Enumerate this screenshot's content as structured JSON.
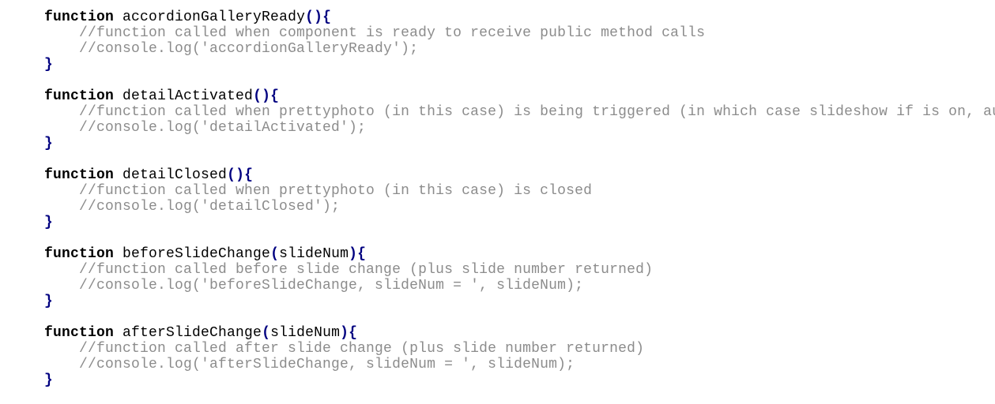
{
  "keyword": "function",
  "blocks": [
    {
      "name": "accordionGalleryReady",
      "param": "",
      "comment1": "//function called when component is ready to receive public method calls",
      "comment2": "//console.log('accordionGalleryReady');"
    },
    {
      "name": "detailActivated",
      "param": "",
      "comment1": "//function called when prettyphoto (in this case) is being triggered (in which case slideshow if is on, au",
      "comment2": "//console.log('detailActivated');"
    },
    {
      "name": "detailClosed",
      "param": "",
      "comment1": "//function called when prettyphoto (in this case) is closed",
      "comment2": "//console.log('detailClosed');"
    },
    {
      "name": "beforeSlideChange",
      "param": "slideNum",
      "comment1": "//function called before slide change (plus slide number returned)",
      "comment2": "//console.log('beforeSlideChange, slideNum = ', slideNum);"
    },
    {
      "name": "afterSlideChange",
      "param": "slideNum",
      "comment1": "//function called after slide change (plus slide number returned)",
      "comment2": "//console.log('afterSlideChange, slideNum = ', slideNum);"
    }
  ]
}
